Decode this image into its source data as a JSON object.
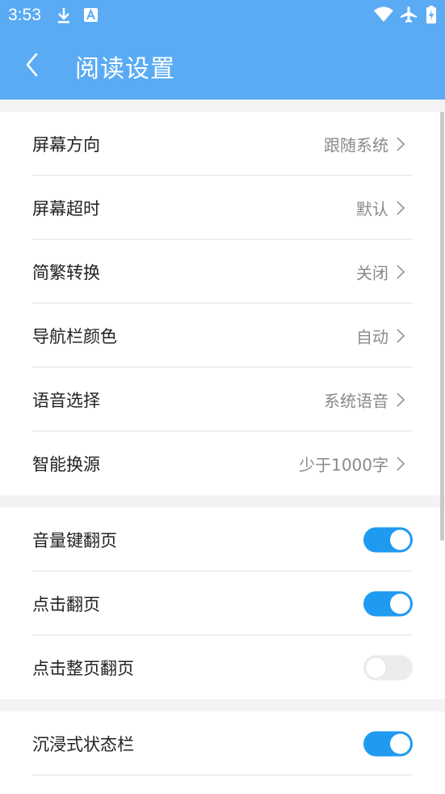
{
  "status_bar": {
    "time": "3:53",
    "icons": [
      "download-icon",
      "notification-a-icon",
      "wifi-icon",
      "airplane-icon",
      "battery-charging-icon"
    ]
  },
  "toolbar": {
    "title": "阅读设置",
    "back_icon": "chevron-left-icon"
  },
  "colors": {
    "header": "#5aabf4",
    "toggle_on": "#1e9bf0",
    "toggle_off": "#ececec",
    "background": "#f3f3f3"
  },
  "section1": {
    "items": [
      {
        "label": "屏幕方向",
        "value": "跟随系统"
      },
      {
        "label": "屏幕超时",
        "value": "默认"
      },
      {
        "label": "简繁转换",
        "value": "关闭"
      },
      {
        "label": "导航栏颜色",
        "value": "自动"
      },
      {
        "label": "语音选择",
        "value": "系统语音"
      },
      {
        "label": "智能换源",
        "value": "少于1000字"
      }
    ]
  },
  "section2": {
    "items": [
      {
        "label": "音量键翻页",
        "on": true
      },
      {
        "label": "点击翻页",
        "on": true
      },
      {
        "label": "点击整页翻页",
        "on": false
      }
    ]
  },
  "section3": {
    "items": [
      {
        "label": "沉浸式状态栏",
        "on": true
      }
    ]
  }
}
